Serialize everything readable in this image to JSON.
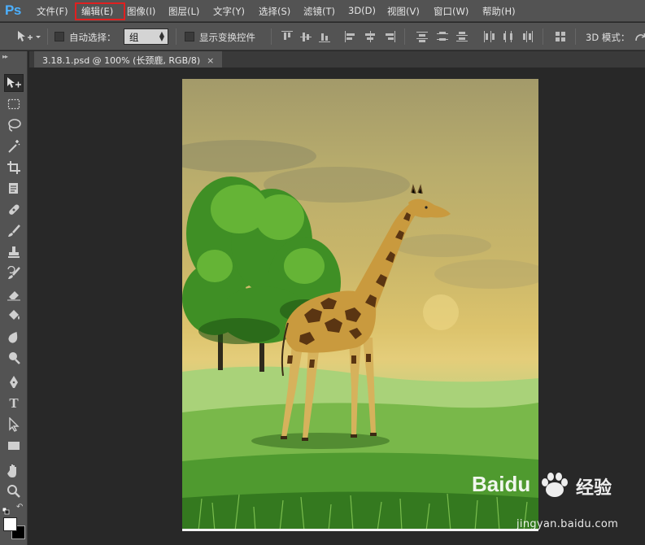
{
  "app": {
    "logo": "Ps"
  },
  "menu": {
    "items": [
      {
        "label": "文件(F)"
      },
      {
        "label": "编辑(E)"
      },
      {
        "label": "图像(I)"
      },
      {
        "label": "图层(L)"
      },
      {
        "label": "文字(Y)"
      },
      {
        "label": "选择(S)"
      },
      {
        "label": "滤镜(T)"
      },
      {
        "label": "3D(D)"
      },
      {
        "label": "视图(V)"
      },
      {
        "label": "窗口(W)"
      },
      {
        "label": "帮助(H)"
      }
    ],
    "highlighted_index": 1,
    "highlight_color": "#e02020"
  },
  "options": {
    "move_tool_icon": "move-tool-icon",
    "auto_select_label": "自动选择：",
    "auto_select_checked": false,
    "auto_select_value": "组",
    "show_transform_label": "显示变换控件",
    "show_transform_checked": false,
    "mode_3d_label": "3D 模式："
  },
  "document": {
    "tab_title": "3.18.1.psd @ 100% (长颈鹿, RGB/8)",
    "close_glyph": "×"
  },
  "tools": [
    "move-tool-icon",
    "marquee-tool-icon",
    "lasso-tool-icon",
    "magic-wand-tool-icon",
    "crop-tool-icon",
    "eyedropper-tool-icon",
    "healing-brush-tool-icon",
    "brush-tool-icon",
    "clone-stamp-tool-icon",
    "history-brush-tool-icon",
    "eraser-tool-icon",
    "paint-bucket-tool-icon",
    "blur-tool-icon",
    "dodge-tool-icon",
    "pen-tool-icon",
    "type-tool-icon",
    "path-selection-tool-icon",
    "rectangle-tool-icon",
    "hand-tool-icon",
    "zoom-tool-icon"
  ],
  "type_tool_glyph": "T",
  "colors": {
    "foreground": "#ffffff",
    "background": "#000000",
    "ui_panel": "#535353",
    "workspace": "#282828",
    "ps_blue": "#4cb0ff"
  },
  "watermark": {
    "logo": "Baidu",
    "text": "经验",
    "url": "jingyan.baidu.com"
  }
}
